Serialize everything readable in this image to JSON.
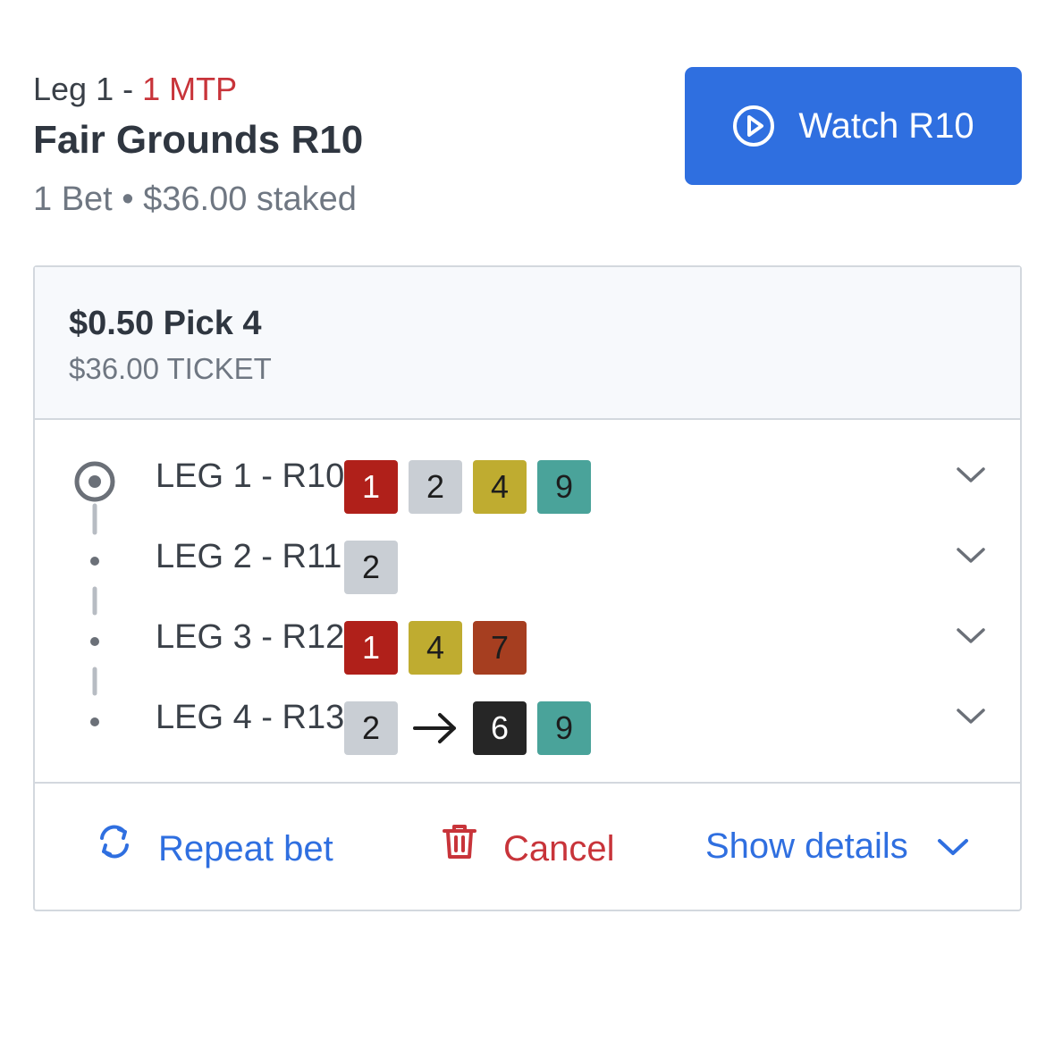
{
  "header": {
    "leg_prefix": "Leg 1 - ",
    "mtp": "1 MTP",
    "track": "Fair Grounds R10",
    "summary": "1 Bet • $36.00 staked",
    "watch_label": "Watch R10"
  },
  "bet": {
    "type": "$0.50 Pick 4",
    "ticket": "$36.00 TICKET",
    "legs": [
      {
        "label": "LEG 1 - R10",
        "active": true,
        "runners": [
          {
            "n": "1",
            "color": "#b0201a"
          },
          {
            "n": "2",
            "color": "#c9ced4"
          },
          {
            "n": "4",
            "color": "#bfac30"
          },
          {
            "n": "9",
            "color": "#4aa39a"
          }
        ]
      },
      {
        "label": "LEG 2 - R11",
        "active": false,
        "runners": [
          {
            "n": "2",
            "color": "#c9ced4"
          }
        ]
      },
      {
        "label": "LEG 3 - R12",
        "active": false,
        "runners": [
          {
            "n": "1",
            "color": "#b0201a"
          },
          {
            "n": "4",
            "color": "#bfac30"
          },
          {
            "n": "7",
            "color": "#a63e20"
          }
        ]
      },
      {
        "label": "LEG 4 - R13",
        "active": false,
        "runners_before": [
          {
            "n": "2",
            "color": "#c9ced4"
          }
        ],
        "runners_after": [
          {
            "n": "6",
            "color": "#262626"
          },
          {
            "n": "9",
            "color": "#4aa39a"
          }
        ]
      }
    ]
  },
  "actions": {
    "repeat": "Repeat bet",
    "cancel": "Cancel",
    "details": "Show details"
  },
  "icons": {
    "watch": "play-circle-icon",
    "repeat": "repeat-icon",
    "cancel": "trash-icon",
    "details": "chevron-down-icon",
    "leg_expand": "chevron-down-icon",
    "swap": "arrow-right-icon"
  },
  "colors": {
    "accent": "#2f6fe0",
    "danger": "#c8343a"
  }
}
